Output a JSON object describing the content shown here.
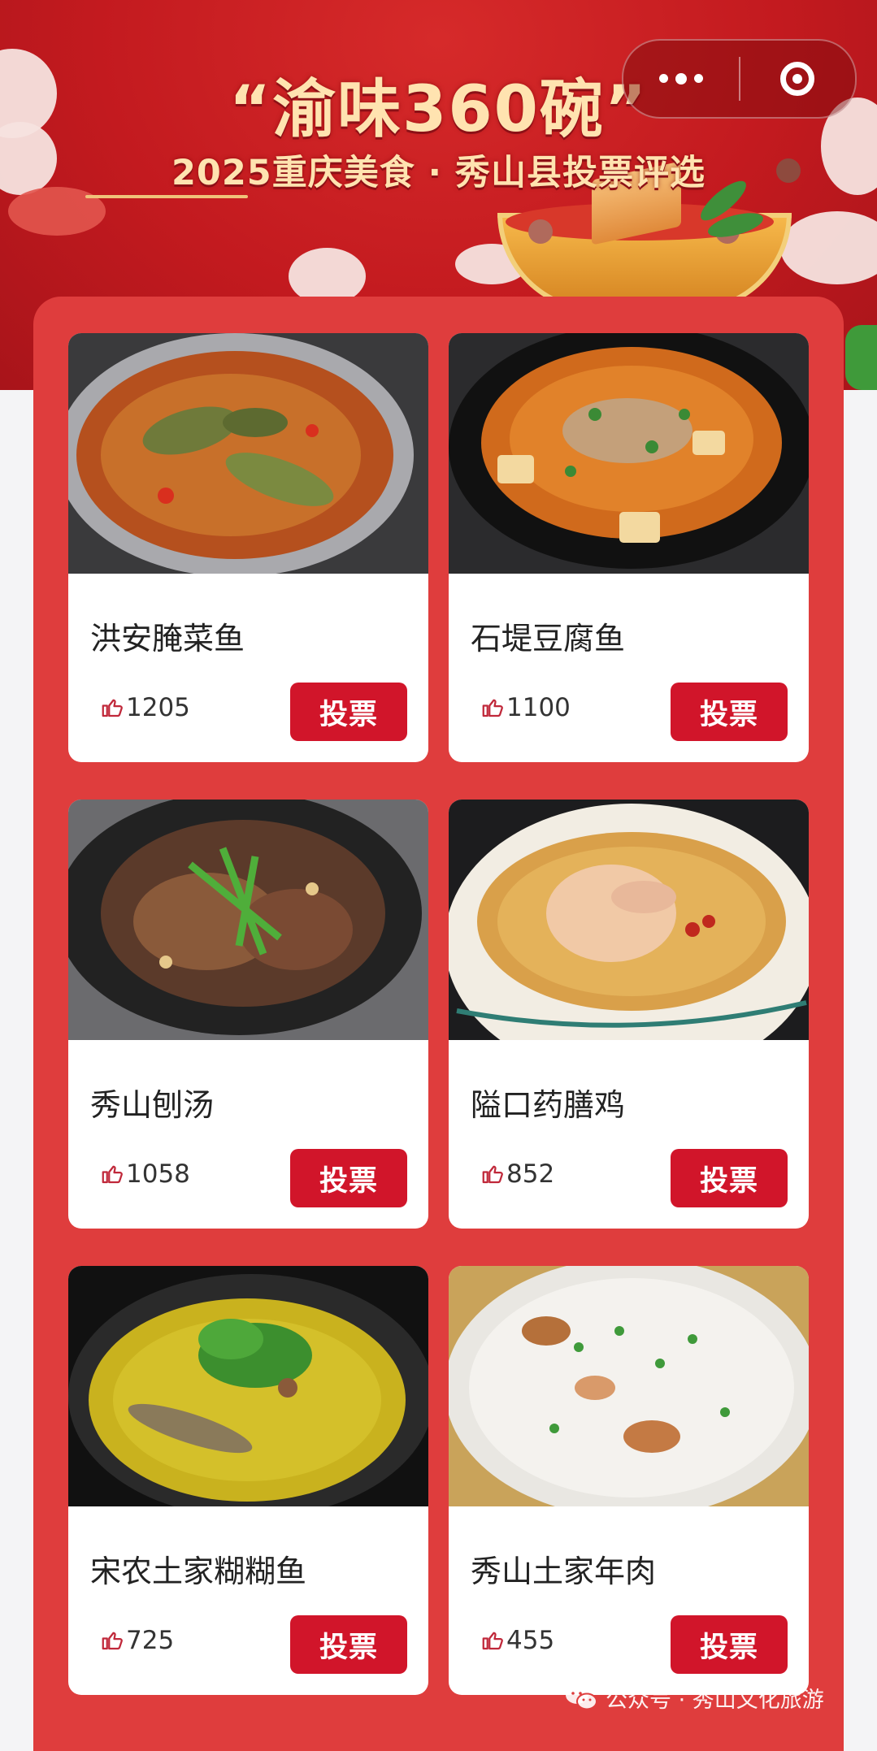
{
  "banner": {
    "title": "“渝味360碗”",
    "subtitle": "2025重庆美食 · 秀山县投票评选"
  },
  "capsule": {
    "more_icon": "more-dots-icon",
    "close_icon": "mini-program-close-icon"
  },
  "dishes": [
    {
      "name": "洪安腌菜鱼",
      "likes": "1205",
      "vote_label": "投票"
    },
    {
      "name": "石堤豆腐鱼",
      "likes": "1100",
      "vote_label": "投票"
    },
    {
      "name": "秀山刨汤",
      "likes": "1058",
      "vote_label": "投票"
    },
    {
      "name": "隘口药膳鸡",
      "likes": "852",
      "vote_label": "投票"
    },
    {
      "name": "宋农土家糊糊鱼",
      "likes": "725",
      "vote_label": "投票"
    },
    {
      "name": "秀山土家年肉",
      "likes": "455",
      "vote_label": "投票"
    }
  ],
  "watermark": {
    "text": "公众号 · 秀山文化旅游"
  },
  "colors": {
    "banner_red": "#c31a1f",
    "panel_red": "#df3d3d",
    "vote_button": "#d1152a",
    "title_gold": "#ffe3b0"
  }
}
